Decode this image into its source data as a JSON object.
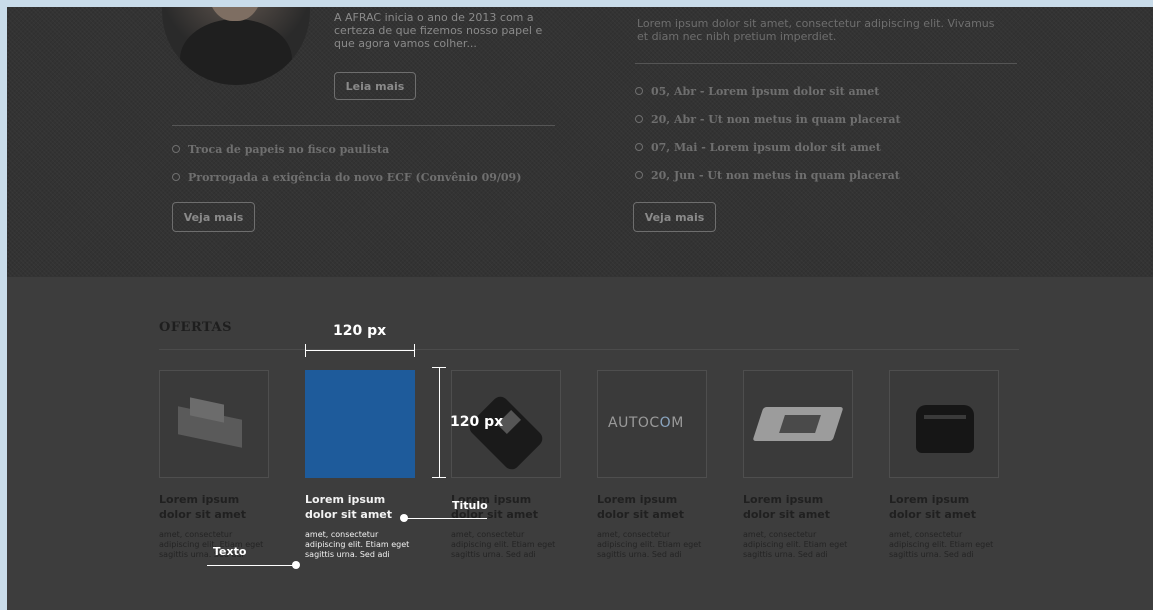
{
  "top": {
    "intro_text": "A AFRAC inicia o ano de 2013 com a certeza de que fizemos nosso papel e que agora vamos colher...",
    "read_more": "Leia mais",
    "left_items": [
      "Troca de papeis no fisco paulista",
      "Prorrogada a exigência do novo ECF (Convênio 09/09)"
    ],
    "see_more_left": "Veja mais",
    "right_text": "Lorem ipsum dolor sit amet, consectetur adipiscing elit. Vivamus et diam nec nibh pretium imperdiet.",
    "right_items": [
      "05, Abr - Lorem ipsum dolor sit amet",
      "20, Abr - Ut non metus in quam placerat",
      "07, Mai - Lorem ipsum dolor sit amet",
      "20, Jun - Ut non metus in quam placerat"
    ],
    "see_more_right": "Veja mais"
  },
  "offers": {
    "title": "OFERTAS",
    "products": [
      {
        "icon": "cash-register-icon",
        "title": "Lorem ipsum dolor sit amet",
        "text": "amet, consectetur adipiscing elit. Etiam eget sagittis urna. Sed adi"
      },
      {
        "icon": "placeholder-block",
        "title": "Lorem ipsum dolor sit amet",
        "text": "amet, consectetur adipiscing elit. Etiam eget sagittis urna. Sed adi"
      },
      {
        "icon": "pinpad-icon",
        "title": "Lorem ipsum dolor sit amet",
        "text": "amet, consectetur adipiscing elit. Etiam eget sagittis urna. Sed adi"
      },
      {
        "icon": "autocom-logo",
        "logo_text": "AUTOCOM",
        "title": "Lorem ipsum dolor sit amet",
        "text": "amet, consectetur adipiscing elit. Etiam eget sagittis urna. Sed adi"
      },
      {
        "icon": "scale-icon",
        "title": "Lorem ipsum dolor sit amet",
        "text": "amet, consectetur adipiscing elit. Etiam eget sagittis urna. Sed adi"
      },
      {
        "icon": "printer-icon",
        "title": "Lorem ipsum dolor sit amet",
        "text": "amet, consectetur adipiscing elit. Etiam eget sagittis urna. Sed adi"
      }
    ]
  },
  "annotations": {
    "width_label": "120 px",
    "height_label": "120 px",
    "title_label": "Titulo",
    "text_label": "Texto"
  },
  "colors": {
    "highlight_block": "#1e5b9b",
    "page_border": "#c9dcea"
  }
}
